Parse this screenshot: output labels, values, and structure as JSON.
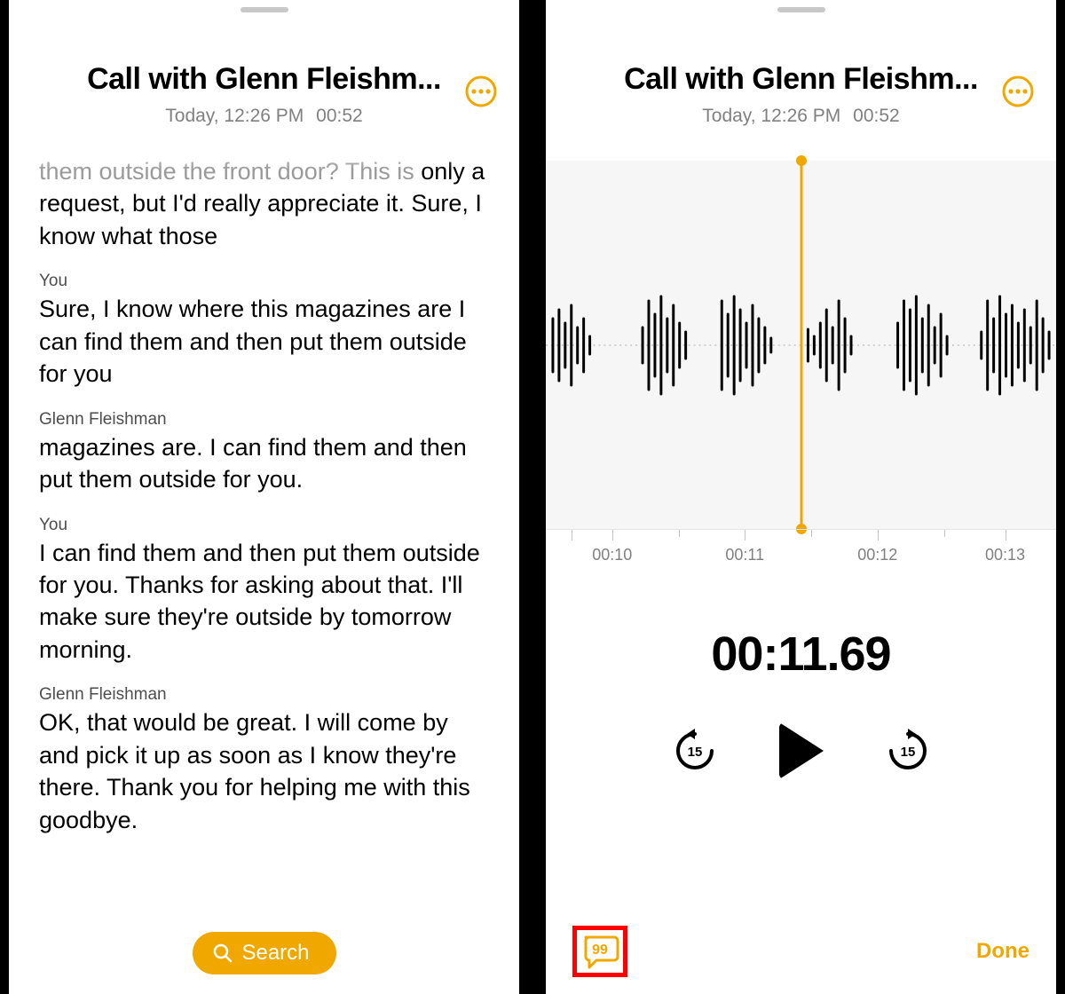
{
  "header": {
    "title": "Call with Glenn Fleishm...",
    "date": "Today, 12:26 PM",
    "duration": "00:52"
  },
  "transcript": {
    "lead_faded": "them outside the front door? This is",
    "lead_rest": "only a request, but I'd really appreciate it. Sure, I know what those",
    "blocks": [
      {
        "speaker": "You",
        "text": "Sure, I know where this magazines are I can find them and then put them outside for you"
      },
      {
        "speaker": "Glenn Fleishman",
        "text": "magazines are. I can find them and then put them outside for you."
      },
      {
        "speaker": "You",
        "text": "I can find them and then put them outside for you. Thanks for asking about that. I'll make sure they're outside by tomorrow morning."
      },
      {
        "speaker": "Glenn Fleishman",
        "text": "OK, that would be great. I will come by and pick it up as soon as I know they're there. Thank you for helping me with this goodbye."
      }
    ]
  },
  "search_label": "Search",
  "player": {
    "current_time": "00:11.69",
    "ruler": [
      "00:10",
      "00:11",
      "00:12",
      "00:13"
    ],
    "done_label": "Done",
    "skip_seconds": "15"
  }
}
